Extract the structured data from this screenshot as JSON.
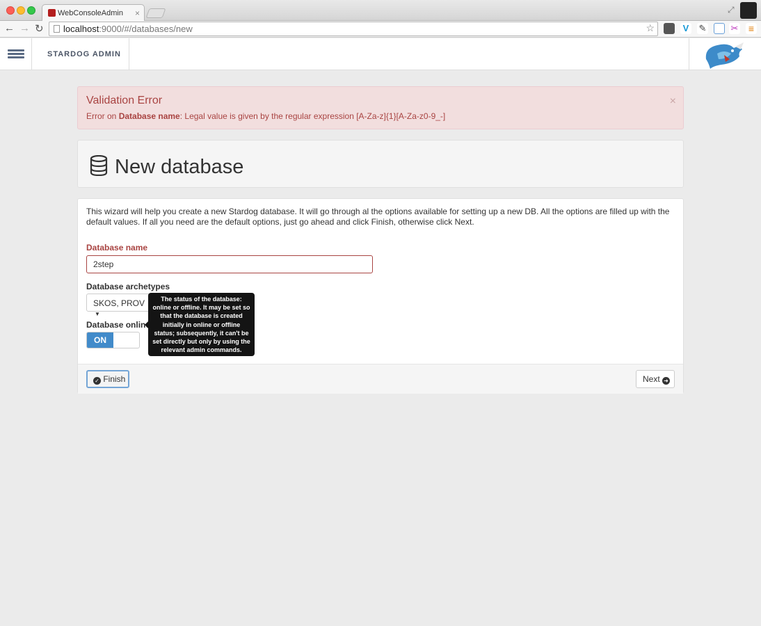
{
  "browser": {
    "tab_title": "WebConsoleAdmin",
    "tab_close": "×",
    "url_host": "localhost",
    "url_rest": ":9000/#/databases/new"
  },
  "navbar": {
    "brand": "STARDOG ADMIN"
  },
  "alert": {
    "title": "Validation Error",
    "prefix": "Error on ",
    "field": "Database name",
    "message": ": Legal value is given by the regular expression [A-Za-z]{1}[A-Za-z0-9_-]",
    "close": "×"
  },
  "header": {
    "title": "New database"
  },
  "form": {
    "intro": "This wizard will help you create a new Stardog database. It will go through al the options available for setting up a new DB. All the options are filled up with the default values. If all you need are the default options, just go ahead and click Finish, otherwise click Next.",
    "name_label": "Database name",
    "name_value": "2step",
    "archetypes_label": "Database archetypes",
    "archetypes_value": "SKOS, PROV",
    "online_label": "Database online",
    "online_toggle": "ON",
    "finish_label": "Finish",
    "next_label": "Next"
  },
  "tooltip": {
    "text": "The status of the database: online or offline. It may be set so that the database is created initially in online or offline status; subsequently, it can't be set directly but only by using the relevant admin commands."
  },
  "icons": {
    "back": "back-arrow-icon",
    "forward": "forward-arrow-icon",
    "reload": "reload-icon",
    "star": "bookmark-star-icon",
    "db": "database-icon",
    "finish": "check-circle-icon",
    "next": "arrow-circle-right-icon"
  },
  "colors": {
    "error": "#a94442",
    "alert_bg": "#f2dede",
    "toggle_on": "#428bca",
    "page_bg": "#ebebeb"
  }
}
